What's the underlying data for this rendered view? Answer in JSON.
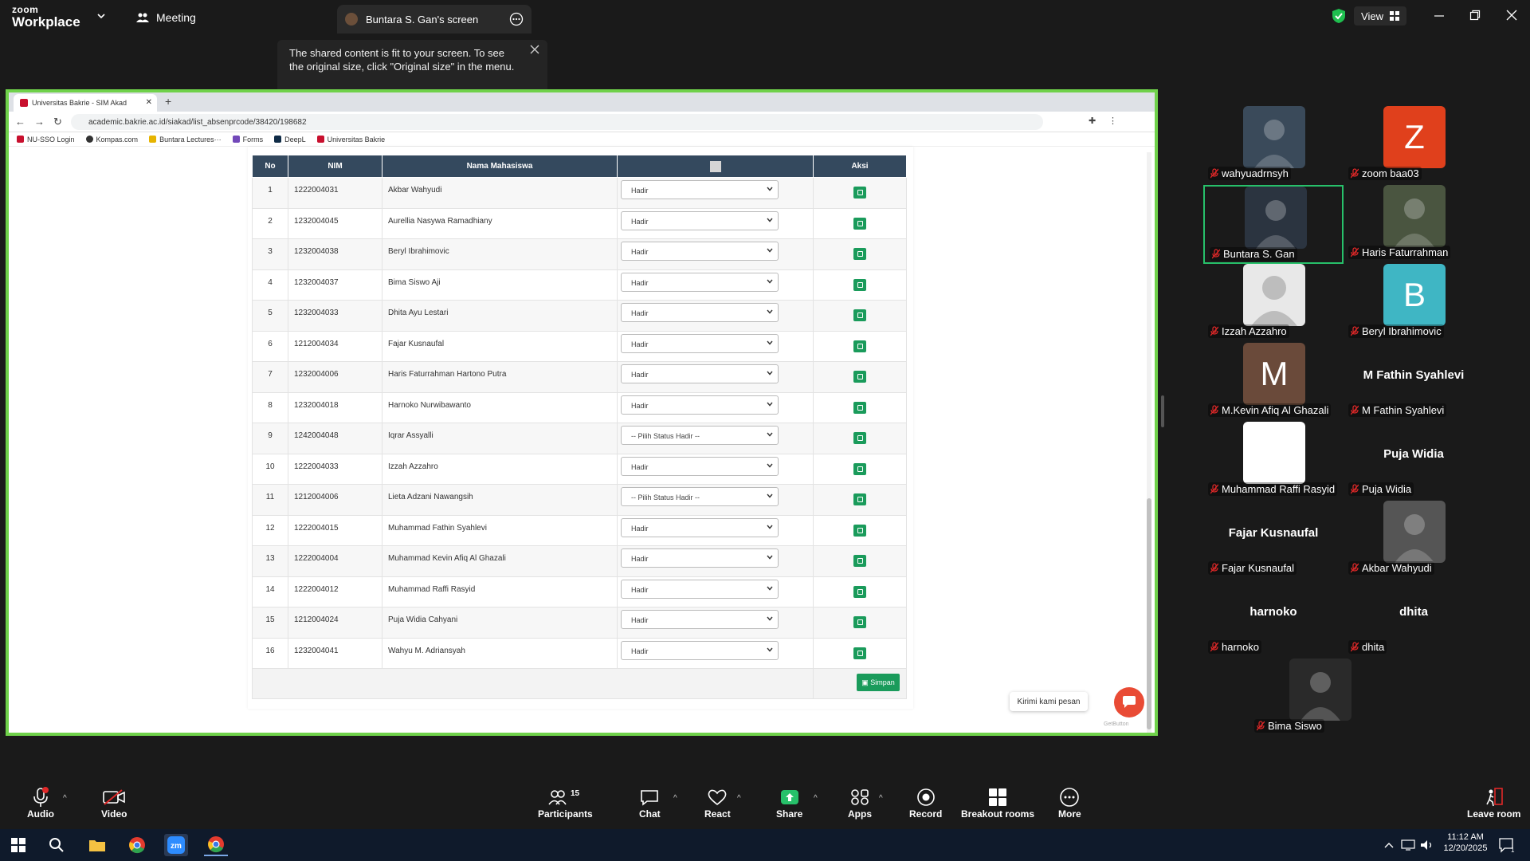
{
  "zoom_top": {
    "logo_top": "zoom",
    "logo_bottom": "Workplace",
    "meeting_label": "Meeting",
    "share_tab_label": "Buntara S. Gan's screen",
    "view_label": "View"
  },
  "tooltip": {
    "text": "The shared content is fit to your screen. To see the original size, click \"Original size\" in the menu."
  },
  "browser": {
    "tab_title": "Universitas Bakrie - SIM Akad",
    "url": "academic.bakrie.ac.id/siakad/list_absenprcode/38420/198682",
    "bookmarks": [
      "NU-SSO Login",
      "Kompas.com",
      "Buntara Lectures···",
      "Forms",
      "DeepL",
      "Universitas Bakrie"
    ]
  },
  "table": {
    "headers": {
      "no": "No",
      "nim": "NIM",
      "nama": "Nama Mahasiswa",
      "aksi": "Aksi"
    },
    "rows": [
      {
        "no": "1",
        "nim": "1222004031",
        "nama": "Akbar Wahyudi",
        "status": "Hadir"
      },
      {
        "no": "2",
        "nim": "1232004045",
        "nama": "Aurellia Nasywa Ramadhiany",
        "status": "Hadir"
      },
      {
        "no": "3",
        "nim": "1232004038",
        "nama": "Beryl Ibrahimovic",
        "status": "Hadir"
      },
      {
        "no": "4",
        "nim": "1232004037",
        "nama": "Bima Siswo Aji",
        "status": "Hadir"
      },
      {
        "no": "5",
        "nim": "1232004033",
        "nama": "Dhita Ayu Lestari",
        "status": "Hadir"
      },
      {
        "no": "6",
        "nim": "1212004034",
        "nama": "Fajar Kusnaufal",
        "status": "Hadir"
      },
      {
        "no": "7",
        "nim": "1232004006",
        "nama": "Haris Faturrahman Hartono Putra",
        "status": "Hadir"
      },
      {
        "no": "8",
        "nim": "1232004018",
        "nama": "Harnoko Nurwibawanto",
        "status": "Hadir"
      },
      {
        "no": "9",
        "nim": "1242004048",
        "nama": "Iqrar Assyalli",
        "status": "-- Pilih Status Hadir --"
      },
      {
        "no": "10",
        "nim": "1222004033",
        "nama": "Izzah Azzahro",
        "status": "Hadir"
      },
      {
        "no": "11",
        "nim": "1212004006",
        "nama": "Lieta Adzani Nawangsih",
        "status": "-- Pilih Status Hadir --"
      },
      {
        "no": "12",
        "nim": "1222004015",
        "nama": "Muhammad Fathin Syahlevi",
        "status": "Hadir"
      },
      {
        "no": "13",
        "nim": "1222004004",
        "nama": "Muhammad Kevin Afiq Al Ghazali",
        "status": "Hadir"
      },
      {
        "no": "14",
        "nim": "1222004012",
        "nama": "Muhammad Raffi Rasyid",
        "status": "Hadir"
      },
      {
        "no": "15",
        "nim": "1212004024",
        "nama": "Puja Widia Cahyani",
        "status": "Hadir"
      },
      {
        "no": "16",
        "nim": "1232004041",
        "nama": "Wahyu M. Adriansyah",
        "status": "Hadir"
      }
    ],
    "save_label": "Simpan"
  },
  "chat_widget": {
    "pill": "Kirimi kami pesan",
    "brand": "GetButton"
  },
  "participants": [
    {
      "name": "wahyuadrnsyh",
      "kind": "photo",
      "color": "#3a4a5a"
    },
    {
      "name": "zoom baa03",
      "kind": "letter",
      "letter": "Z",
      "color": "#e0401c"
    },
    {
      "name": "Buntara S. Gan",
      "kind": "photo",
      "color": "#2b3440"
    },
    {
      "name": "Haris Faturrahman",
      "kind": "photo",
      "color": "#4a5540"
    },
    {
      "name": "Izzah Azzahro",
      "kind": "default",
      "color": "#e8e8e8"
    },
    {
      "name": "Beryl Ibrahimovic",
      "kind": "letter",
      "letter": "B",
      "color": "#3fb6c4"
    },
    {
      "name": "M.Kevin Afiq Al Ghazali",
      "kind": "letter",
      "letter": "M",
      "color": "#6a4a3a"
    },
    {
      "name": "M Fathin Syahlevi",
      "kind": "text",
      "display": "M Fathin Syahlevi"
    },
    {
      "name": "Muhammad Raffi Rasyid",
      "kind": "blank",
      "color": "#ffffff"
    },
    {
      "name": "Puja Widia",
      "kind": "text",
      "display": "Puja Widia"
    },
    {
      "name": "Fajar Kusnaufal",
      "kind": "text",
      "display": "Fajar Kusnaufal"
    },
    {
      "name": "Akbar Wahyudi",
      "kind": "photo",
      "color": "#555555"
    },
    {
      "name": "harnoko",
      "kind": "text",
      "display": "harnoko"
    },
    {
      "name": "dhita",
      "kind": "text",
      "display": "dhita"
    },
    {
      "name": "Bima Siswo",
      "kind": "photo",
      "color": "#2a2a2a"
    }
  ],
  "bottombar": {
    "audio": "Audio",
    "video": "Video",
    "participants": "Participants",
    "participants_count": "15",
    "chat": "Chat",
    "react": "React",
    "share": "Share",
    "apps": "Apps",
    "record": "Record",
    "breakout": "Breakout rooms",
    "more": "More",
    "leave": "Leave room"
  },
  "taskbar": {
    "time": "11:12 AM",
    "date": "12/20/2025",
    "notif_count": "1"
  },
  "colors": {
    "accent_green": "#6fd14a",
    "table_header": "#34495e",
    "action_green": "#1a9b5b"
  }
}
